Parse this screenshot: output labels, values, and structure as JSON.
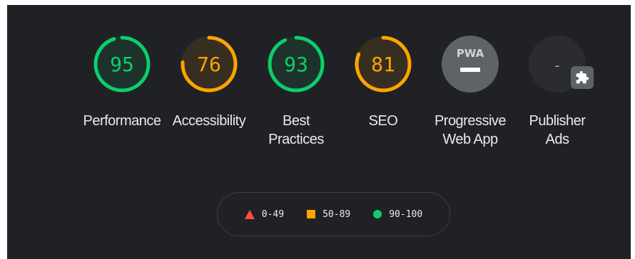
{
  "colors": {
    "pass": "#0cce6b",
    "average": "#ffa400",
    "fail": "#ff4e42",
    "na": "#5f6368"
  },
  "gauges": [
    {
      "label": "Performance",
      "score": "95",
      "value": 95,
      "status": "pass"
    },
    {
      "label": "Accessibility",
      "score": "76",
      "value": 76,
      "status": "average"
    },
    {
      "label": "Best\nPractices",
      "score": "93",
      "value": 93,
      "status": "pass"
    },
    {
      "label": "SEO",
      "score": "81",
      "value": 81,
      "status": "average"
    },
    {
      "label": "Progressive\nWeb App",
      "badge": "PWA",
      "status": "na"
    },
    {
      "label": "Publisher\nAds",
      "score": "-",
      "status": "na",
      "icon": "puzzle-icon"
    }
  ],
  "legend": [
    {
      "range": "0-49",
      "shape": "triangle"
    },
    {
      "range": "50-89",
      "shape": "square"
    },
    {
      "range": "90-100",
      "shape": "circle"
    }
  ]
}
